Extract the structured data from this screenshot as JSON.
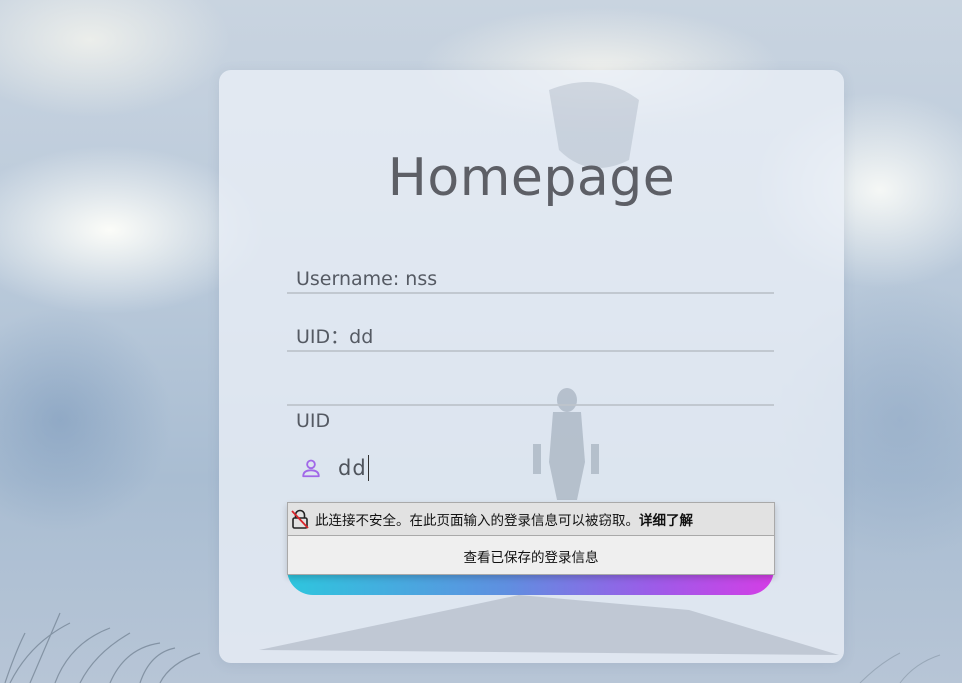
{
  "page": {
    "title": "Homepage"
  },
  "form": {
    "username_label": "Username: ",
    "username_value": "nss",
    "uid_display_label": "UID：",
    "uid_display_value": "dd",
    "uid_label": "UID",
    "uid_input_value": "dd"
  },
  "autofill_popup": {
    "warning_text": "此连接不安全。在此页面输入的登录信息可以被窃取。",
    "learn_more": "详细了解",
    "view_saved": "查看已保存的登录信息"
  },
  "colors": {
    "gradient_start": "#2ec6de",
    "gradient_end": "#d43ee6",
    "person_icon": "#a168e8"
  },
  "icons": {
    "person": "person-icon",
    "insecure_lock": "insecure-lock-icon"
  }
}
